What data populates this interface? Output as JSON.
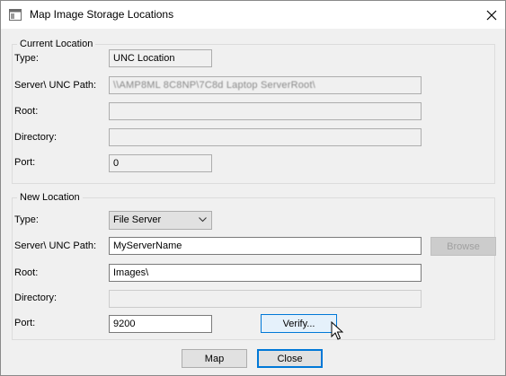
{
  "window": {
    "title": "Map Image Storage Locations",
    "icons": {
      "app": "app-window-icon",
      "close": "close-icon",
      "dropdown": "chevron-down-icon",
      "cursor": "mouse-pointer-icon"
    }
  },
  "current_location": {
    "legend": "Current Location",
    "type_label": "Type:",
    "type_value": "UNC Location",
    "server_label": "Server\\ UNC Path:",
    "server_value": "\\\\AMP8ML 8C8NP\\7C8d Laptop ServerRoot\\",
    "root_label": "Root:",
    "root_value": "",
    "directory_label": "Directory:",
    "directory_value": "",
    "port_label": "Port:",
    "port_value": "0"
  },
  "new_location": {
    "legend": "New Location",
    "type_label": "Type:",
    "type_value": "File Server",
    "server_label": "Server\\ UNC Path:",
    "server_value": "MyServerName",
    "browse_label": "Browse",
    "root_label": "Root:",
    "root_value": "Images\\",
    "directory_label": "Directory:",
    "directory_value": "",
    "port_label": "Port:",
    "port_value": "9200",
    "verify_label": "Verify..."
  },
  "footer": {
    "map_label": "Map",
    "close_label": "Close"
  }
}
